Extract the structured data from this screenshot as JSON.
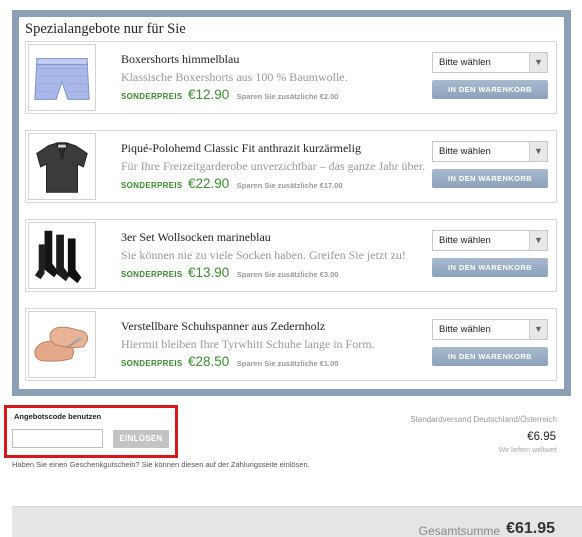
{
  "offers": {
    "title": "Spezialangebote nur für Sie",
    "items": [
      {
        "name": "Boxershorts himmelblau",
        "description": "Klassische Boxershorts aus 100 % Baumwolle.",
        "price_label": "SONDERPREIS",
        "price": "€12.90",
        "savings": "Sparen Sie zusätzliche €2.00",
        "select_value": "Bitte wählen",
        "cart_button": "IN DEN WARENKORB",
        "image_icon": "boxershorts-image"
      },
      {
        "name": "Piqué-Polohemd Classic Fit anthrazit kurzärmelig",
        "description": "Für Ihre Freizeitgarderobe unverzichtbar – das ganze Jahr über.",
        "price_label": "SONDERPREIS",
        "price": "€22.90",
        "savings": "Sparen Sie zusätzliche €17.00",
        "select_value": "Bitte wählen",
        "cart_button": "IN DEN WARENKORB",
        "image_icon": "polo-shirt-image"
      },
      {
        "name": "3er Set Wollsocken marineblau",
        "description": "Sie können nie zu viele Socken haben. Greifen Sie jetzt zu!",
        "price_label": "SONDERPREIS",
        "price": "€13.90",
        "savings": "Sparen Sie zusätzliche €3.00",
        "select_value": "Bitte wählen",
        "cart_button": "IN DEN WARENKORB",
        "image_icon": "socks-image"
      },
      {
        "name": "Verstellbare Schuhspanner aus Zedernholz",
        "description": "Hiermit bleiben Ihre Tyrwhitt Schuhe lange in Form.",
        "price_label": "SONDERPREIS",
        "price": "€28.50",
        "savings": "Sparen Sie zusätzliche €1.00",
        "select_value": "Bitte wählen",
        "cart_button": "IN DEN WARENKORB",
        "image_icon": "shoe-trees-image"
      }
    ]
  },
  "coupon": {
    "label": "Angebotscode benutzen",
    "input_value": "",
    "button": "EINLÖSEN",
    "hint": "Haben Sie einen Geschenkgutschein? Sie können diesen auf der Zahlungsseite einlösen."
  },
  "shipping": {
    "label": "Standardversand Deutschland/Österreich",
    "price": "€6.95",
    "note": "Wir liefern weltweit"
  },
  "total": {
    "label": "Gesamtsumme",
    "value": "€61.95"
  },
  "colors": {
    "frame": "#8b9fb5",
    "price_green": "#3a8a2e",
    "cart_button": "#9bb0c7",
    "coupon_highlight": "#d9161c"
  }
}
